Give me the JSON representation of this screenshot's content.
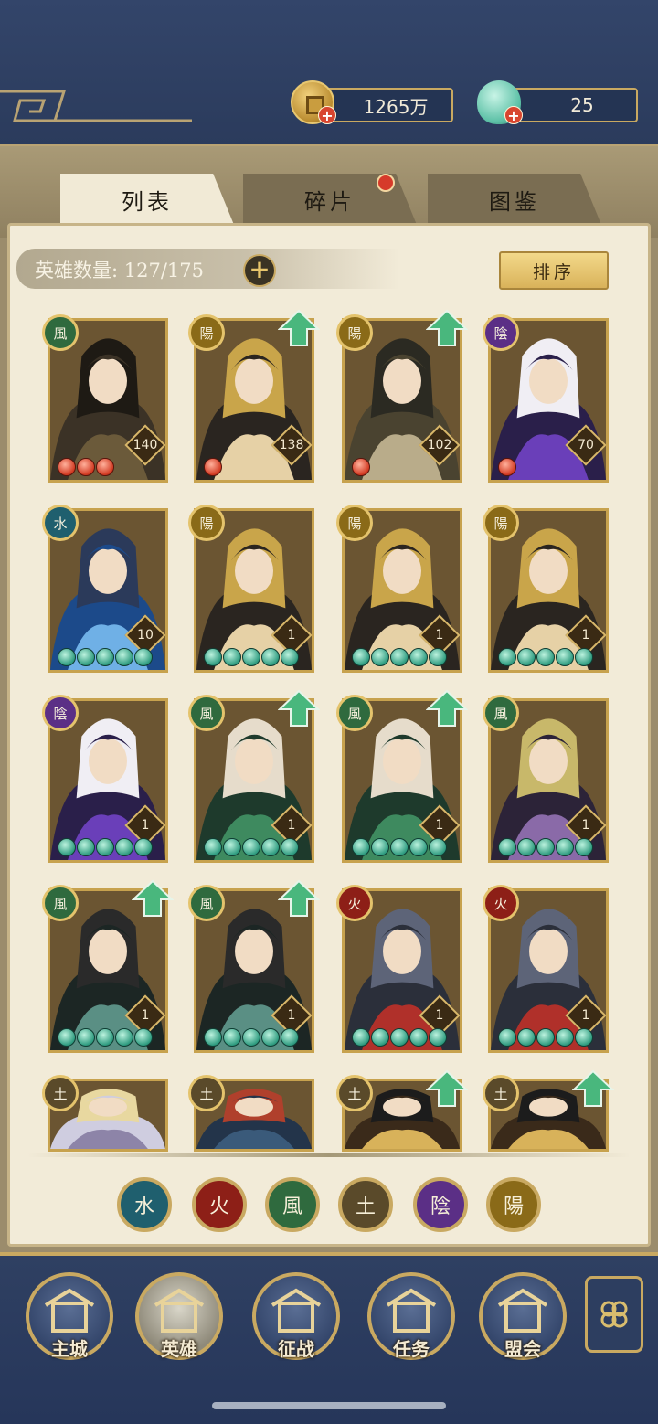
{
  "currency": {
    "coins": "1265万",
    "jade": "25"
  },
  "tabs": [
    {
      "label": "列表",
      "active": true
    },
    {
      "label": "碎片",
      "active": false,
      "has_notification": true
    },
    {
      "label": "图鉴",
      "active": false
    }
  ],
  "hero_count_label": "英雄数量: 127/175",
  "sort_label": "排序",
  "elements": {
    "wind": {
      "glyph": "風",
      "color": "#2f6a3e"
    },
    "yang": {
      "glyph": "陽",
      "color": "#8a6a18"
    },
    "yin": {
      "glyph": "陰",
      "color": "#5b2f86"
    },
    "water": {
      "glyph": "水",
      "color": "#1f5f6e"
    },
    "fire": {
      "glyph": "火",
      "color": "#8d1f17"
    },
    "earth": {
      "glyph": "土",
      "color": "#5a4a2a"
    }
  },
  "heroes": [
    {
      "element": "wind",
      "level": "140",
      "orbs": 3,
      "orb_type": "red",
      "upgrade": false,
      "palette": [
        "#3b3226",
        "#6b5a3a",
        "#1e1a14"
      ]
    },
    {
      "element": "yang",
      "level": "138",
      "orbs": 1,
      "orb_type": "red",
      "upgrade": true,
      "palette": [
        "#2a2520",
        "#e6d1a6",
        "#c9a54a"
      ]
    },
    {
      "element": "yang",
      "level": "102",
      "orbs": 1,
      "orb_type": "red",
      "upgrade": true,
      "palette": [
        "#4a4330",
        "#b9ac8a",
        "#2b2a22"
      ]
    },
    {
      "element": "yin",
      "level": "70",
      "orbs": 1,
      "orb_type": "red",
      "upgrade": false,
      "palette": [
        "#2a1f4a",
        "#6a3fb9",
        "#f0eef4"
      ]
    },
    {
      "element": "water",
      "level": "10",
      "orbs": 5,
      "orb_type": "jade",
      "upgrade": false,
      "palette": [
        "#1c4a8a",
        "#6fb0e6",
        "#2b3a5a"
      ]
    },
    {
      "element": "yang",
      "level": "1",
      "orbs": 5,
      "orb_type": "jade",
      "upgrade": false,
      "palette": [
        "#2a2520",
        "#e6d1a6",
        "#c9a54a"
      ]
    },
    {
      "element": "yang",
      "level": "1",
      "orbs": 5,
      "orb_type": "jade",
      "upgrade": false,
      "palette": [
        "#2a2520",
        "#e6d1a6",
        "#c9a54a"
      ]
    },
    {
      "element": "yang",
      "level": "1",
      "orbs": 5,
      "orb_type": "jade",
      "upgrade": false,
      "palette": [
        "#2a2520",
        "#e6d1a6",
        "#c9a54a"
      ]
    },
    {
      "element": "yin",
      "level": "1",
      "orbs": 5,
      "orb_type": "jade",
      "upgrade": false,
      "palette": [
        "#2a1f4a",
        "#6a3fb9",
        "#f0eef4"
      ]
    },
    {
      "element": "wind",
      "level": "1",
      "orbs": 5,
      "orb_type": "jade",
      "upgrade": true,
      "palette": [
        "#1e3a2c",
        "#3e8a5f",
        "#e6dccb"
      ]
    },
    {
      "element": "wind",
      "level": "1",
      "orbs": 5,
      "orb_type": "jade",
      "upgrade": true,
      "palette": [
        "#1e3a2c",
        "#3e8a5f",
        "#e6dccb"
      ]
    },
    {
      "element": "wind",
      "level": "1",
      "orbs": 5,
      "orb_type": "jade",
      "upgrade": false,
      "palette": [
        "#2c2338",
        "#8a6aa8",
        "#c8b86a"
      ]
    },
    {
      "element": "wind",
      "level": "1",
      "orbs": 5,
      "orb_type": "jade",
      "upgrade": true,
      "palette": [
        "#1c2624",
        "#5a8f84",
        "#2a2a2a"
      ]
    },
    {
      "element": "wind",
      "level": "1",
      "orbs": 5,
      "orb_type": "jade",
      "upgrade": true,
      "palette": [
        "#1c2624",
        "#5a8f84",
        "#2a2a2a"
      ]
    },
    {
      "element": "fire",
      "level": "1",
      "orbs": 5,
      "orb_type": "jade",
      "upgrade": false,
      "palette": [
        "#2b2f3a",
        "#b0302a",
        "#5d6478"
      ]
    },
    {
      "element": "fire",
      "level": "1",
      "orbs": 5,
      "orb_type": "jade",
      "upgrade": false,
      "palette": [
        "#2b2f3a",
        "#b0302a",
        "#5d6478"
      ]
    },
    {
      "element": "earth",
      "level": "",
      "orbs": 0,
      "orb_type": "jade",
      "upgrade": false,
      "palette": [
        "#cfcde0",
        "#8d84a8",
        "#e8d8a0"
      ]
    },
    {
      "element": "earth",
      "level": "",
      "orbs": 0,
      "orb_type": "jade",
      "upgrade": false,
      "palette": [
        "#23344a",
        "#3a5a7a",
        "#b0402c"
      ]
    },
    {
      "element": "earth",
      "level": "",
      "orbs": 0,
      "orb_type": "jade",
      "upgrade": true,
      "palette": [
        "#3a2a1a",
        "#d8b25a",
        "#1c1c1c"
      ]
    },
    {
      "element": "earth",
      "level": "",
      "orbs": 0,
      "orb_type": "jade",
      "upgrade": true,
      "palette": [
        "#3a2a1a",
        "#d8b25a",
        "#1c1c1c"
      ]
    }
  ],
  "filters": [
    "water",
    "fire",
    "wind",
    "earth",
    "yin",
    "yang"
  ],
  "nav": [
    {
      "label": "主城",
      "icon": "city-gate-icon",
      "active": false
    },
    {
      "label": "英雄",
      "icon": "hero-portrait-icon",
      "active": true
    },
    {
      "label": "征战",
      "icon": "battle-drum-icon",
      "active": false
    },
    {
      "label": "任务",
      "icon": "quest-bell-icon",
      "active": false
    },
    {
      "label": "盟会",
      "icon": "guild-hall-icon",
      "active": false
    }
  ],
  "menu_icon": "flower-menu-icon"
}
